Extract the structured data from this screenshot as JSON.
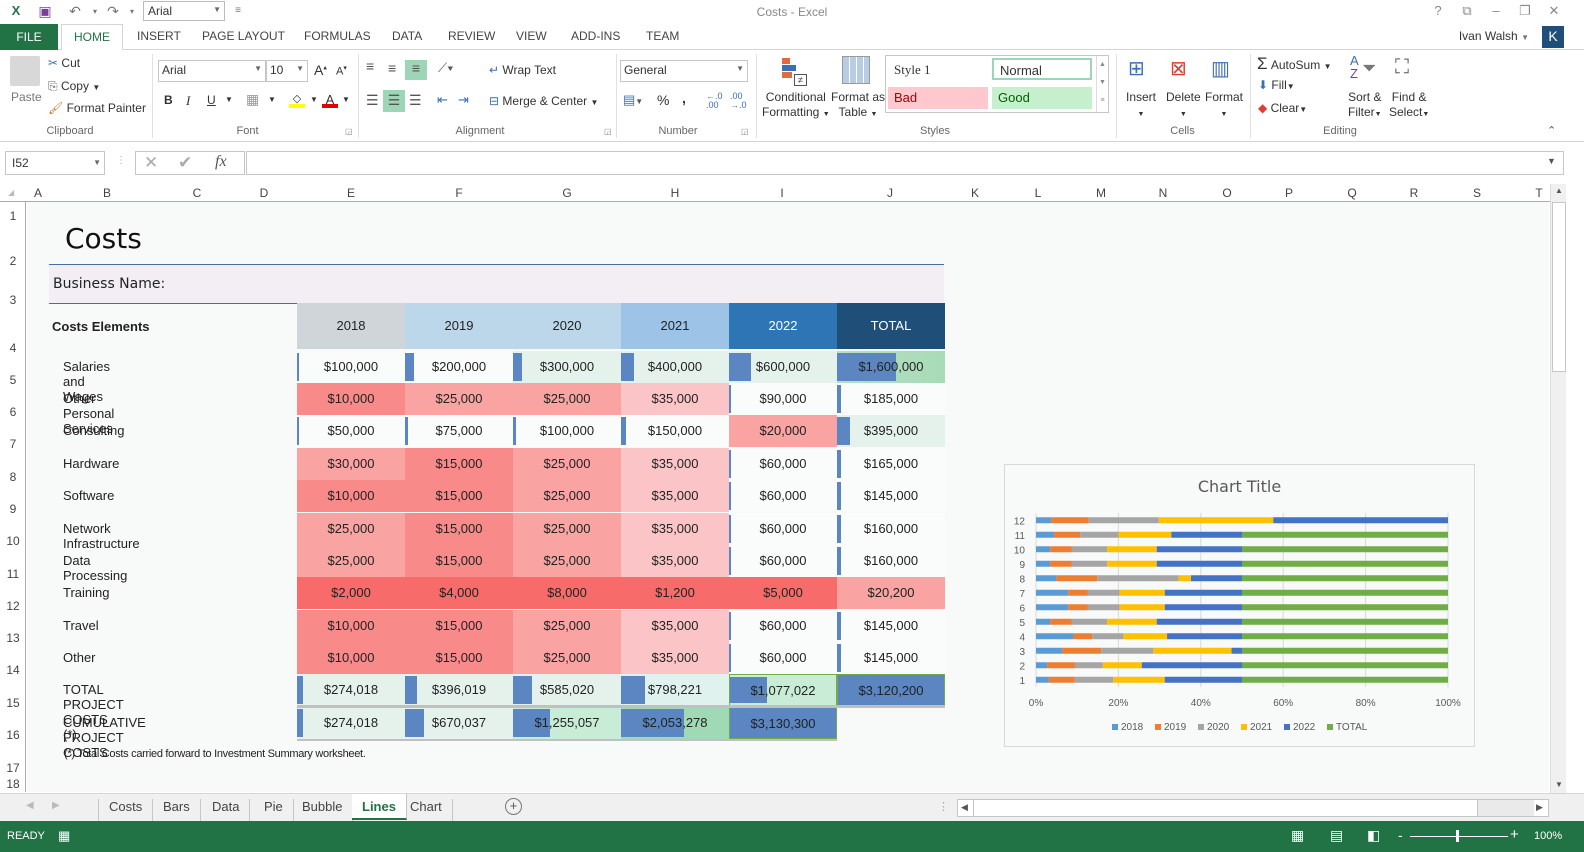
{
  "window": {
    "title": "Costs - Excel",
    "font_quick": "Arial",
    "controls": [
      "?",
      "⧉",
      "—",
      "❐",
      "✕"
    ]
  },
  "user": {
    "name": "Ivan Walsh",
    "avatar": "K"
  },
  "ribbon_tabs": [
    "FILE",
    "HOME",
    "INSERT",
    "PAGE LAYOUT",
    "FORMULAS",
    "DATA",
    "REVIEW",
    "VIEW",
    "ADD-INS",
    "TEAM"
  ],
  "ribbon": {
    "clipboard": {
      "paste": "Paste",
      "cut": "Cut",
      "copy": "Copy",
      "format_painter": "Format Painter",
      "label": "Clipboard"
    },
    "font": {
      "name": "Arial",
      "size": "10",
      "bold": "B",
      "italic": "I",
      "underline": "U",
      "label": "Font"
    },
    "alignment": {
      "wrap": "Wrap Text",
      "merge": "Merge & Center",
      "label": "Alignment"
    },
    "number": {
      "format": "General",
      "percent": "%",
      "comma": ",",
      "label": "Number"
    },
    "styles": {
      "conditional": "Conditional",
      "conditional2": "Formatting",
      "format_table": "Format as",
      "format_table2": "Table",
      "style1": "Style 1",
      "normal": "Normal",
      "bad": "Bad",
      "good": "Good",
      "label": "Styles"
    },
    "cells": {
      "insert": "Insert",
      "delete": "Delete",
      "format": "Format",
      "label": "Cells"
    },
    "editing": {
      "autosum": "AutoSum",
      "fill": "Fill",
      "clear": "Clear",
      "sort": "Sort &",
      "sort2": "Filter",
      "find": "Find &",
      "find2": "Select",
      "label": "Editing"
    }
  },
  "formula_bar": {
    "name_box": "I52",
    "formula": ""
  },
  "columns": [
    "A",
    "B",
    "C",
    "D",
    "E",
    "F",
    "G",
    "H",
    "I",
    "J",
    "K",
    "L",
    "M",
    "N",
    "O",
    "P",
    "Q",
    "R",
    "S",
    "T"
  ],
  "rows": [
    "1",
    "2",
    "3",
    "4",
    "5",
    "6",
    "7",
    "8",
    "9",
    "10",
    "11",
    "12",
    "13",
    "14",
    "15",
    "16",
    "17",
    "18"
  ],
  "sheet": {
    "title": "Costs",
    "business_name_label": "Business Name:",
    "elements_header": "Costs Elements",
    "year_headers": [
      "2018",
      "2019",
      "2020",
      "2021",
      "2022",
      "TOTAL"
    ],
    "line_items": [
      {
        "name": "Salaries and Wages",
        "values": [
          "$100,000",
          "$200,000",
          "$300,000",
          "$400,000",
          "$600,000",
          "$1,600,000"
        ]
      },
      {
        "name": "Other Personal Services",
        "values": [
          "$10,000",
          "$25,000",
          "$25,000",
          "$35,000",
          "$90,000",
          "$185,000"
        ]
      },
      {
        "name": "Consulting",
        "values": [
          "$50,000",
          "$75,000",
          "$100,000",
          "$150,000",
          "$20,000",
          "$395,000"
        ]
      },
      {
        "name": "Hardware",
        "values": [
          "$30,000",
          "$15,000",
          "$25,000",
          "$35,000",
          "$60,000",
          "$165,000"
        ]
      },
      {
        "name": "Software",
        "values": [
          "$10,000",
          "$15,000",
          "$25,000",
          "$35,000",
          "$60,000",
          "$145,000"
        ]
      },
      {
        "name": "Network Infrastructure",
        "values": [
          "$25,000",
          "$15,000",
          "$25,000",
          "$35,000",
          "$60,000",
          "$160,000"
        ]
      },
      {
        "name": "Data Processing",
        "values": [
          "$25,000",
          "$15,000",
          "$25,000",
          "$35,000",
          "$60,000",
          "$160,000"
        ]
      },
      {
        "name": "Training",
        "values": [
          "$2,000",
          "$4,000",
          "$8,000",
          "$1,200",
          "$5,000",
          "$20,200"
        ]
      },
      {
        "name": "Travel",
        "values": [
          "$10,000",
          "$15,000",
          "$25,000",
          "$35,000",
          "$60,000",
          "$145,000"
        ]
      },
      {
        "name": "Other",
        "values": [
          "$10,000",
          "$15,000",
          "$25,000",
          "$35,000",
          "$60,000",
          "$145,000"
        ]
      }
    ],
    "total_row": {
      "name": "TOTAL PROJECT COSTS  (*)",
      "values": [
        "$274,018",
        "$396,019",
        "$585,020",
        "$798,221",
        "$1,077,022",
        "$3,120,200"
      ]
    },
    "cumulative_row": {
      "name": "CUMULATIVE PROJECT COSTS",
      "values": [
        "$274,018",
        "$670,037",
        "$1,255,057",
        "$2,053,278",
        "$3,130,300"
      ]
    },
    "footnote": "(*) Total Costs carried forward to Investment Summary worksheet."
  },
  "chart_data": {
    "type": "bar",
    "stacked": "100%",
    "orientation": "horizontal",
    "title": "Chart Title",
    "categories": [
      "1",
      "2",
      "3",
      "4",
      "5",
      "6",
      "7",
      "8",
      "9",
      "10",
      "11",
      "12"
    ],
    "xlim": [
      0,
      100
    ],
    "xticks": [
      "0%",
      "20%",
      "40%",
      "60%",
      "80%",
      "100%"
    ],
    "legend_position": "bottom",
    "series": [
      {
        "name": "2018",
        "color": "#5b9bd5",
        "values": [
          100000,
          10000,
          50000,
          30000,
          10000,
          25000,
          25000,
          2000,
          10000,
          10000,
          274018,
          274018
        ]
      },
      {
        "name": "2019",
        "color": "#ed7d31",
        "values": [
          200000,
          25000,
          75000,
          15000,
          15000,
          15000,
          15000,
          4000,
          15000,
          15000,
          396019,
          670037
        ]
      },
      {
        "name": "2020",
        "color": "#a5a5a5",
        "values": [
          300000,
          25000,
          100000,
          25000,
          25000,
          25000,
          25000,
          8000,
          25000,
          25000,
          585020,
          1255057
        ]
      },
      {
        "name": "2021",
        "color": "#ffc000",
        "values": [
          400000,
          35000,
          150000,
          35000,
          35000,
          35000,
          35000,
          1200,
          35000,
          35000,
          798221,
          2053278
        ]
      },
      {
        "name": "2022",
        "color": "#4472c4",
        "values": [
          600000,
          90000,
          20000,
          60000,
          60000,
          60000,
          60000,
          5000,
          60000,
          60000,
          1077022,
          3130300
        ]
      },
      {
        "name": "TOTAL",
        "color": "#70ad47",
        "values": [
          1600000,
          185000,
          395000,
          165000,
          145000,
          160000,
          160000,
          20200,
          145000,
          145000,
          3120200,
          0
        ]
      }
    ]
  },
  "sheet_tabs": [
    "Costs",
    "Bars",
    "Data",
    "Pie",
    "Bubble",
    "Lines",
    "Chart"
  ],
  "active_sheet": "Lines",
  "status": {
    "mode": "READY",
    "zoom": "100%"
  }
}
